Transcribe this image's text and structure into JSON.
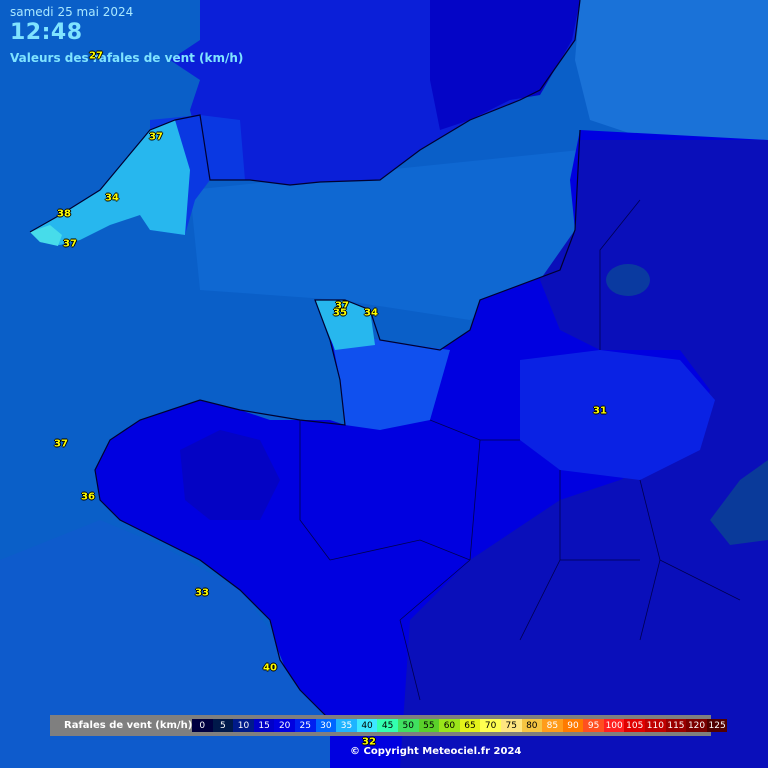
{
  "header": {
    "date": "samedi 25 mai 2024",
    "time": "12:48",
    "subtitle": "Valeurs des rafales de vent (km/h)"
  },
  "colors": {
    "sea": "#0a5fc8",
    "land_20": "#0b1fd8",
    "land_25": "#0000e0",
    "land_30": "#1050ee",
    "land_35": "#27b7ee",
    "land_40": "#47dcea",
    "calm_15": "#0a0fba",
    "deep_land": "#0403c4"
  },
  "stations": [
    {
      "value": "37"
    },
    {
      "value": "34"
    },
    {
      "value": "38"
    },
    {
      "value": "37"
    },
    {
      "value": "37"
    },
    {
      "value": "35"
    },
    {
      "value": "34"
    },
    {
      "value": "31"
    },
    {
      "value": "37"
    },
    {
      "value": "36"
    },
    {
      "value": "33"
    },
    {
      "value": "40"
    },
    {
      "value": "32"
    },
    {
      "value": "27"
    }
  ],
  "legend": {
    "title": "Rafales de vent (km/h)",
    "bins": [
      {
        "label": "0",
        "color": "#000040",
        "text": "#ffffff"
      },
      {
        "label": "5",
        "color": "#00194a",
        "text": "#ffffff"
      },
      {
        "label": "10",
        "color": "#001a8a",
        "text": "#ffffff"
      },
      {
        "label": "15",
        "color": "#0000c8",
        "text": "#ffffff"
      },
      {
        "label": "20",
        "color": "#0000e0",
        "text": "#ffffff"
      },
      {
        "label": "25",
        "color": "#0020f0",
        "text": "#ffffff"
      },
      {
        "label": "30",
        "color": "#0066ff",
        "text": "#ffffff"
      },
      {
        "label": "35",
        "color": "#1eb4ff",
        "text": "#ffffff"
      },
      {
        "label": "40",
        "color": "#3ee8ff",
        "text": "#000000"
      },
      {
        "label": "45",
        "color": "#33ffb0",
        "text": "#000000"
      },
      {
        "label": "50",
        "color": "#40e060",
        "text": "#000000"
      },
      {
        "label": "55",
        "color": "#5ad02a",
        "text": "#000000"
      },
      {
        "label": "60",
        "color": "#9ae51a",
        "text": "#000000"
      },
      {
        "label": "65",
        "color": "#e4f21a",
        "text": "#000000"
      },
      {
        "label": "70",
        "color": "#ffff50",
        "text": "#000000"
      },
      {
        "label": "75",
        "color": "#ffe680",
        "text": "#000000"
      },
      {
        "label": "80",
        "color": "#f5c542",
        "text": "#000000"
      },
      {
        "label": "85",
        "color": "#ff9c1a",
        "text": "#ffffff"
      },
      {
        "label": "90",
        "color": "#ff7a00",
        "text": "#ffffff"
      },
      {
        "label": "95",
        "color": "#ff5020",
        "text": "#ffffff"
      },
      {
        "label": "100",
        "color": "#ff2020",
        "text": "#ffffff"
      },
      {
        "label": "105",
        "color": "#e00000",
        "text": "#ffffff"
      },
      {
        "label": "110",
        "color": "#c00000",
        "text": "#ffffff"
      },
      {
        "label": "115",
        "color": "#9a0000",
        "text": "#ffffff"
      },
      {
        "label": "120",
        "color": "#7a0000",
        "text": "#ffffff"
      },
      {
        "label": "125",
        "color": "#500000",
        "text": "#ffffff"
      }
    ]
  },
  "copyright": "© Copyright Meteociel.fr 2024"
}
